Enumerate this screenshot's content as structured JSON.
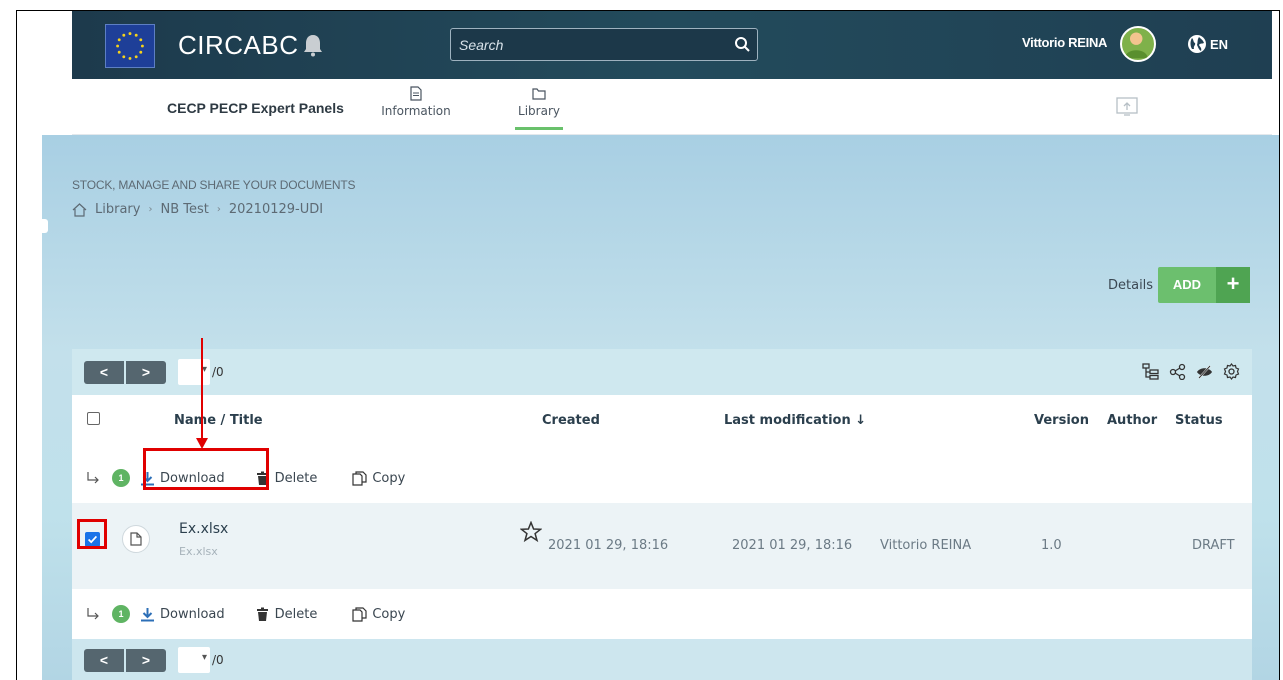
{
  "app": {
    "title": "CIRCABC",
    "search_placeholder": "Search",
    "user_name": "Vittorio REINA",
    "language": "EN"
  },
  "group": {
    "name": "CECP PECP Expert Panels",
    "tabs": [
      {
        "label": "Information",
        "icon": "document-icon",
        "active": false
      },
      {
        "label": "Library",
        "icon": "folder-icon",
        "active": true
      }
    ]
  },
  "library": {
    "tagline": "STOCK, MANAGE AND SHARE YOUR DOCUMENTS",
    "breadcrumb": [
      "Library",
      "NB Test",
      "20210129-UDI"
    ],
    "details_label": "Details",
    "add_label": "ADD"
  },
  "pager": {
    "prev": "<",
    "next": ">",
    "total": "/0"
  },
  "table": {
    "columns": {
      "name_title": "Name  /  Title",
      "created": "Created",
      "last_modification": "Last modification ↓",
      "version": "Version",
      "author": "Author",
      "status": "Status"
    },
    "actions": {
      "selected_count": "1",
      "download": "Download",
      "delete": "Delete",
      "copy": "Copy"
    },
    "rows": [
      {
        "name": "Ex.xlsx",
        "title": "Ex.xlsx",
        "created": "2021 01 29, 18:16",
        "modified": "2021 01 29, 18:16",
        "author": "Vittorio REINA",
        "version": "1.0",
        "status": "DRAFT",
        "checked": true
      }
    ]
  },
  "colors": {
    "accent_green": "#6cbf6e",
    "top_bar": "#1f3f52",
    "highlight_red": "#e00000"
  }
}
